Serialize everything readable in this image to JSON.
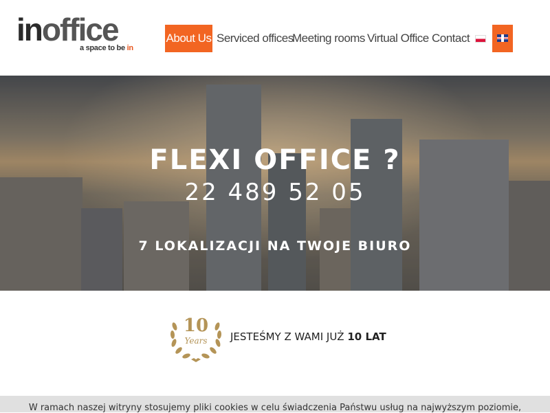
{
  "logo": {
    "brand_in": "in",
    "brand_office": "office",
    "tagline_prefix": "a space to be ",
    "tagline_accent": "in"
  },
  "nav": {
    "items": [
      {
        "label": "About Us",
        "active": true
      },
      {
        "label": "Serviced offices"
      },
      {
        "label": "Meeting rooms"
      },
      {
        "label": "Virtual Office"
      },
      {
        "label": "Contact"
      }
    ],
    "languages": [
      "pl-flag-icon",
      "en-flag-icon"
    ],
    "accent_color": "#f26522"
  },
  "hero": {
    "title": "FLEXI OFFICE ?",
    "phone": "22 489 52 05",
    "subtitle": "7 LOKALIZACJI NA TWOJE BIURO"
  },
  "badge": {
    "number": "10",
    "word": "Years",
    "text_prefix": "JESTEŚMY Z WAMI JUŻ ",
    "text_bold": "10 LAT"
  },
  "cookie_bar": {
    "text": "W ramach naszej witryny stosujemy pliki cookies w celu świadczenia Państwu usług na najwyższym poziomie,"
  }
}
